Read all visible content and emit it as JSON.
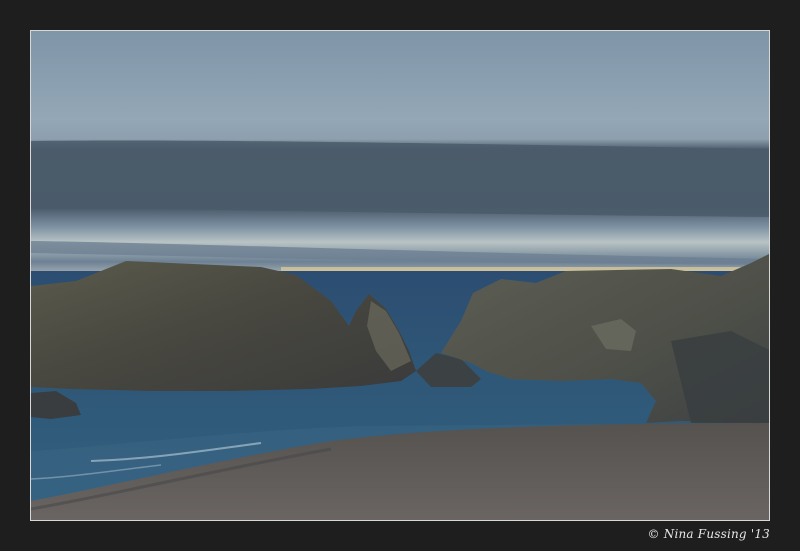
{
  "photo": {
    "subject": "coastal-seascape-dusk",
    "colors": {
      "frame": "#1e1e1e",
      "sky_top": "#8fa5b5",
      "cloud_band": "#4d5d6e",
      "horizon_glow": "#f0d9a0",
      "sea": "#2f5676",
      "sand": "#5e5a58",
      "rock": "#4b4b44"
    }
  },
  "credit": {
    "text": "© Nina Fussing '13"
  }
}
